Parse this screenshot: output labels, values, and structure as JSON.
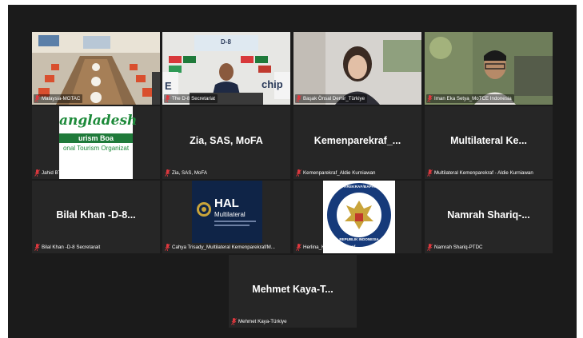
{
  "participants": [
    {
      "label": "Malaysia-MOTAC"
    },
    {
      "label": "The D-8 Secretariat"
    },
    {
      "label": "Başak Önsal Demir_Türkiye"
    },
    {
      "label": "Iman Eka Setya_MoTCE Indonesia"
    },
    {
      "label": "Jahid BTB",
      "logo_text_top": "angladesh",
      "logo_text_band": "urism Boa",
      "logo_text_bottom": "onal Tourism Organizat"
    },
    {
      "label": "Zia, SAS, MoFA",
      "display_name": "Zia, SAS, MoFA"
    },
    {
      "label": "Kemenparekraf_Aldie Kurniawan",
      "display_name": "Kemenparekraf_..."
    },
    {
      "label": "Multilateral Kemenparekraf - Aldie Kurniawan",
      "display_name": "Multilateral Ke..."
    },
    {
      "label": "Bilal Khan -D-8 Secretarait",
      "display_name": "Bilal Khan -D-8..."
    },
    {
      "label": "Cahya Trisady_Multilateral Kemenparekraf/M...",
      "logo_title": "HAL",
      "logo_subtitle": "Multilateral"
    },
    {
      "label": "Herlina_Kemenparekraf",
      "logo_text": "KEMENPAREKRAF/BAPAREKRAF",
      "logo_text_bottom": "REPUBLIK INDONESIA"
    },
    {
      "label": "Namrah Shariq-PTDC",
      "display_name": "Namrah Shariq-..."
    },
    {
      "label": "Mehmet Kaya-Türkiye",
      "display_name": "Mehmet Kaya-T..."
    }
  ],
  "speaker_scene": {
    "banner_top": "D-8",
    "banner_side": "chip",
    "banner_left": "E"
  },
  "colors": {
    "active_speaker_border": "#7fd35a",
    "muted_mic": "#e0383e",
    "tile_bg": "#262626"
  },
  "icons": {
    "muted": "mic-muted-icon"
  }
}
